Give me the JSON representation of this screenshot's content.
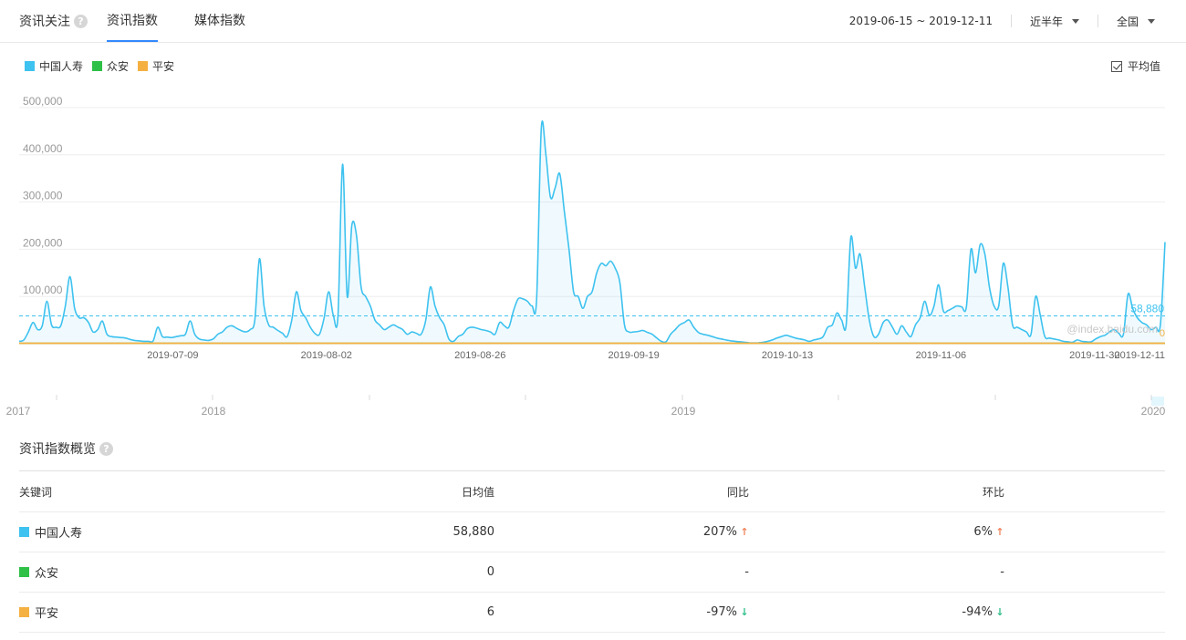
{
  "header": {
    "title": "资讯关注",
    "tabs": [
      {
        "label": "资讯指数",
        "active": true
      },
      {
        "label": "媒体指数",
        "active": false
      }
    ],
    "date_range": "2019-06-15 ~ 2019-12-11",
    "period": "近半年",
    "region": "全国"
  },
  "legend": {
    "items": [
      {
        "label": "中国人寿",
        "color": "#3ec2ef"
      },
      {
        "label": "众安",
        "color": "#2ec047"
      },
      {
        "label": "平安",
        "color": "#f5b042"
      }
    ],
    "avg_label": "平均值",
    "avg_checked": true
  },
  "chart_data": {
    "type": "area",
    "x_start": "2019-06-15",
    "x_end": "2019-12-11",
    "ylim": [
      0,
      500000
    ],
    "yticks": [
      "100,000",
      "200,000",
      "300,000",
      "400,000",
      "500,000"
    ],
    "xtick_labels": [
      "2019-07-09",
      "2019-08-02",
      "2019-08-26",
      "2019-09-19",
      "2019-10-13",
      "2019-11-06",
      "2019-11-30",
      "2019-12-11"
    ],
    "watermark": "@index.baidu.com",
    "series": [
      {
        "name": "中国人寿",
        "color": "#3ec2ef",
        "average": 58880,
        "average_label": "58,880",
        "values": [
          5000,
          8000,
          25000,
          45000,
          30000,
          38000,
          90000,
          40000,
          35000,
          38000,
          80000,
          142000,
          75000,
          55000,
          55000,
          45000,
          25000,
          30000,
          48000,
          20000,
          15000,
          14000,
          13000,
          12000,
          9000,
          7000,
          6000,
          5000,
          5000,
          6000,
          35000,
          15000,
          14000,
          13000,
          15000,
          17000,
          20000,
          48000,
          20000,
          10000,
          8000,
          7000,
          10000,
          20000,
          25000,
          35000,
          38000,
          33000,
          28000,
          25000,
          30000,
          50000,
          180000,
          80000,
          40000,
          35000,
          28000,
          22000,
          15000,
          50000,
          110000,
          70000,
          55000,
          35000,
          22000,
          20000,
          55000,
          110000,
          60000,
          60000,
          380000,
          100000,
          250000,
          230000,
          120000,
          100000,
          80000,
          50000,
          40000,
          30000,
          35000,
          40000,
          35000,
          30000,
          20000,
          25000,
          22000,
          20000,
          50000,
          120000,
          80000,
          55000,
          40000,
          10000,
          5000,
          15000,
          20000,
          32000,
          35000,
          33000,
          30000,
          28000,
          25000,
          20000,
          45000,
          38000,
          35000,
          70000,
          95000,
          95000,
          90000,
          80000,
          95000,
          455000,
          400000,
          310000,
          330000,
          360000,
          280000,
          200000,
          110000,
          100000,
          75000,
          100000,
          110000,
          150000,
          170000,
          165000,
          175000,
          160000,
          130000,
          40000,
          25000,
          25000,
          26000,
          28000,
          24000,
          20000,
          12000,
          5000,
          4000,
          20000,
          30000,
          40000,
          45000,
          50000,
          35000,
          24000,
          20000,
          18000,
          15000,
          12000,
          10000,
          8000,
          6000,
          5000,
          4000,
          3000,
          2000,
          1500,
          2000,
          3000,
          5000,
          8000,
          12000,
          15000,
          18000,
          15000,
          12000,
          10000,
          8000,
          5000,
          8000,
          10000,
          15000,
          35000,
          40000,
          65000,
          50000,
          40000,
          225000,
          160000,
          190000,
          120000,
          50000,
          15000,
          20000,
          45000,
          50000,
          35000,
          20000,
          38000,
          25000,
          15000,
          40000,
          55000,
          90000,
          60000,
          80000,
          125000,
          70000,
          70000,
          75000,
          80000,
          78000,
          77000,
          200000,
          150000,
          210000,
          190000,
          120000,
          80000,
          80000,
          170000,
          120000,
          40000,
          35000,
          30000,
          25000,
          20000,
          100000,
          60000,
          15000,
          12000,
          10000,
          8000,
          5000,
          4000,
          3000,
          8000,
          5000,
          4000,
          4000,
          10000,
          15000,
          18000,
          25000,
          30000,
          22000,
          20000,
          105000,
          75000,
          55000,
          45000,
          40000,
          30000,
          35000,
          40000,
          215000
        ],
        "filled": true
      },
      {
        "name": "众安",
        "color": "#2ec047",
        "average": 0,
        "values": "flat near 0",
        "filled": false
      },
      {
        "name": "平安",
        "color": "#f5b042",
        "average": 6,
        "average_label": "0",
        "values": "flat near 0",
        "filled": false
      }
    ]
  },
  "timeline": {
    "labels": [
      "2017",
      "2018",
      "2019",
      "2020"
    ]
  },
  "overview": {
    "title": "资讯指数概览",
    "columns": {
      "keyword": "关键词",
      "daily_avg": "日均值",
      "yoy": "同比",
      "mom": "环比"
    },
    "rows": [
      {
        "keyword": "中国人寿",
        "color": "#3ec2ef",
        "daily_avg": "58,880",
        "yoy": "207%",
        "yoy_dir": "up",
        "mom": "6%",
        "mom_dir": "up"
      },
      {
        "keyword": "众安",
        "color": "#2ec047",
        "daily_avg": "0",
        "yoy": "-",
        "yoy_dir": "",
        "mom": "-",
        "mom_dir": ""
      },
      {
        "keyword": "平安",
        "color": "#f5b042",
        "daily_avg": "6",
        "yoy": "-97%",
        "yoy_dir": "down",
        "mom": "-94%",
        "mom_dir": "down"
      }
    ]
  }
}
